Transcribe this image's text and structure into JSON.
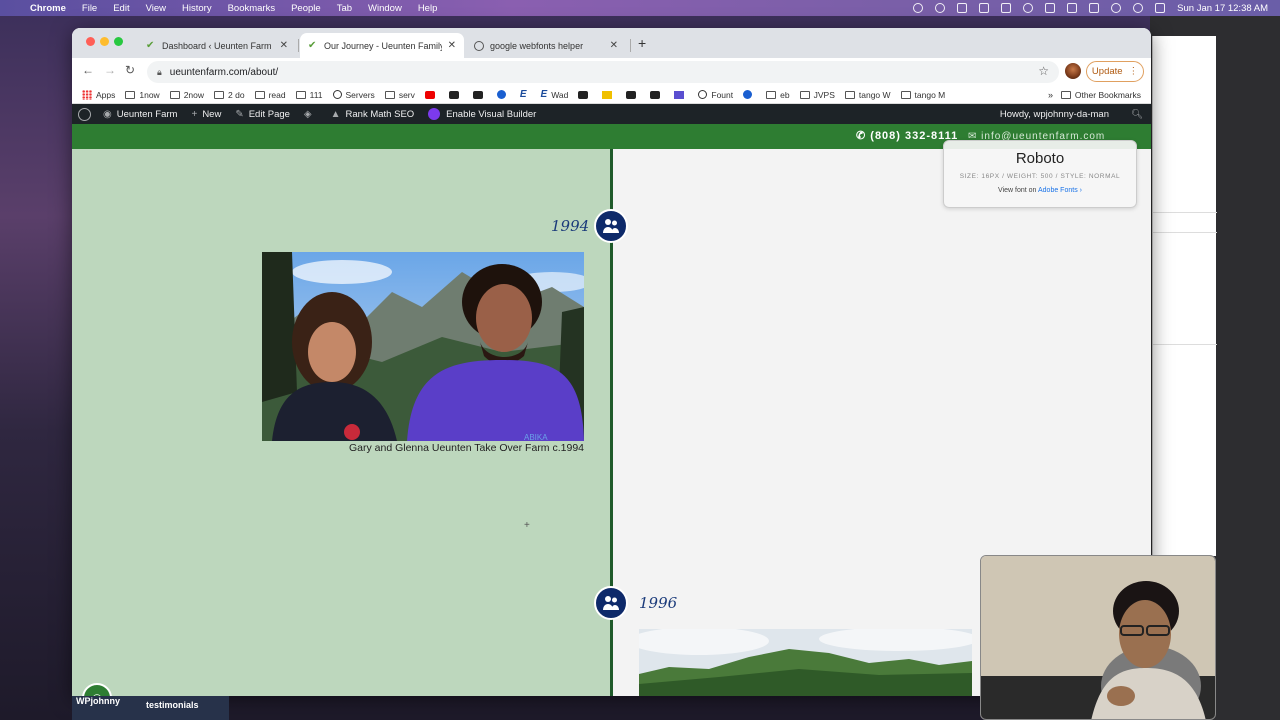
{
  "menubar": {
    "app_name": "Chrome",
    "items": [
      "File",
      "Edit",
      "View",
      "History",
      "Bookmarks",
      "People",
      "Tab",
      "Window",
      "Help"
    ],
    "clock": "Sun Jan 17  12:38 AM"
  },
  "tabs": [
    {
      "title": "Dashboard ‹ Ueunten Farm — W",
      "active": false
    },
    {
      "title": "Our Journey - Ueunten Family",
      "active": true
    },
    {
      "title": "google webfonts helper",
      "active": false
    }
  ],
  "address": {
    "url": "ueuntenfarm.com/about/"
  },
  "toolbar": {
    "update_label": "Update"
  },
  "bookmarks": {
    "items": [
      {
        "label": "Apps",
        "icon": "grid"
      },
      {
        "label": "1now",
        "icon": "folder"
      },
      {
        "label": "2now",
        "icon": "folder"
      },
      {
        "label": "2 do",
        "icon": "folder"
      },
      {
        "label": "read",
        "icon": "folder"
      },
      {
        "label": "111",
        "icon": "folder"
      },
      {
        "label": "Servers",
        "icon": "ccircle"
      },
      {
        "label": "serv",
        "icon": "folder"
      },
      {
        "label": "",
        "icon": "red"
      },
      {
        "label": "",
        "icon": "dark"
      },
      {
        "label": "",
        "icon": "dark"
      },
      {
        "label": "",
        "icon": "blue"
      },
      {
        "label": "",
        "icon": "letter"
      },
      {
        "label": "Wad",
        "icon": "letter"
      },
      {
        "label": "",
        "icon": "dark"
      },
      {
        "label": "",
        "icon": "yellow"
      },
      {
        "label": "",
        "icon": "dark"
      },
      {
        "label": "",
        "icon": "dark"
      },
      {
        "label": "",
        "icon": "purple"
      },
      {
        "label": "Fount",
        "icon": "ccircle"
      },
      {
        "label": "",
        "icon": "blue"
      },
      {
        "label": "eb",
        "icon": "folder"
      },
      {
        "label": "JVPS",
        "icon": "folder"
      },
      {
        "label": "tango W",
        "icon": "folder"
      },
      {
        "label": "tango M",
        "icon": "folder"
      }
    ],
    "overflow": "»",
    "other": "Other Bookmarks"
  },
  "wpbar": {
    "site_name": "Ueunten Farm",
    "new_label": "New",
    "edit_label": "Edit Page",
    "rankmath_label": "Rank Math SEO",
    "builder_label": "Enable Visual Builder",
    "howdy": "Howdy, wpjohnny-da-man"
  },
  "header": {
    "phone": "(808) 332-8111",
    "email_partial": "info@ueuntenfarm.com"
  },
  "timeline": [
    {
      "year": "1994",
      "caption": "Gary and Glenna Ueunten Take Over Farm c.1994"
    },
    {
      "year": "1996",
      "caption": ""
    }
  ],
  "font_tooltip": {
    "name": "Roboto",
    "meta": "SIZE: 16PX / WEIGHT: 500 / STYLE: NORMAL",
    "link_prefix": "View font on",
    "link_text": "Adobe Fonts ›"
  },
  "desktop": {
    "labels": [
      "WPjohnny",
      "testimonials"
    ]
  },
  "colors": {
    "brand_green": "#2e7d32",
    "left_column": "#bdd7bd",
    "timeline_dot": "#0e2a6a",
    "wp_bar": "#1d2327"
  }
}
